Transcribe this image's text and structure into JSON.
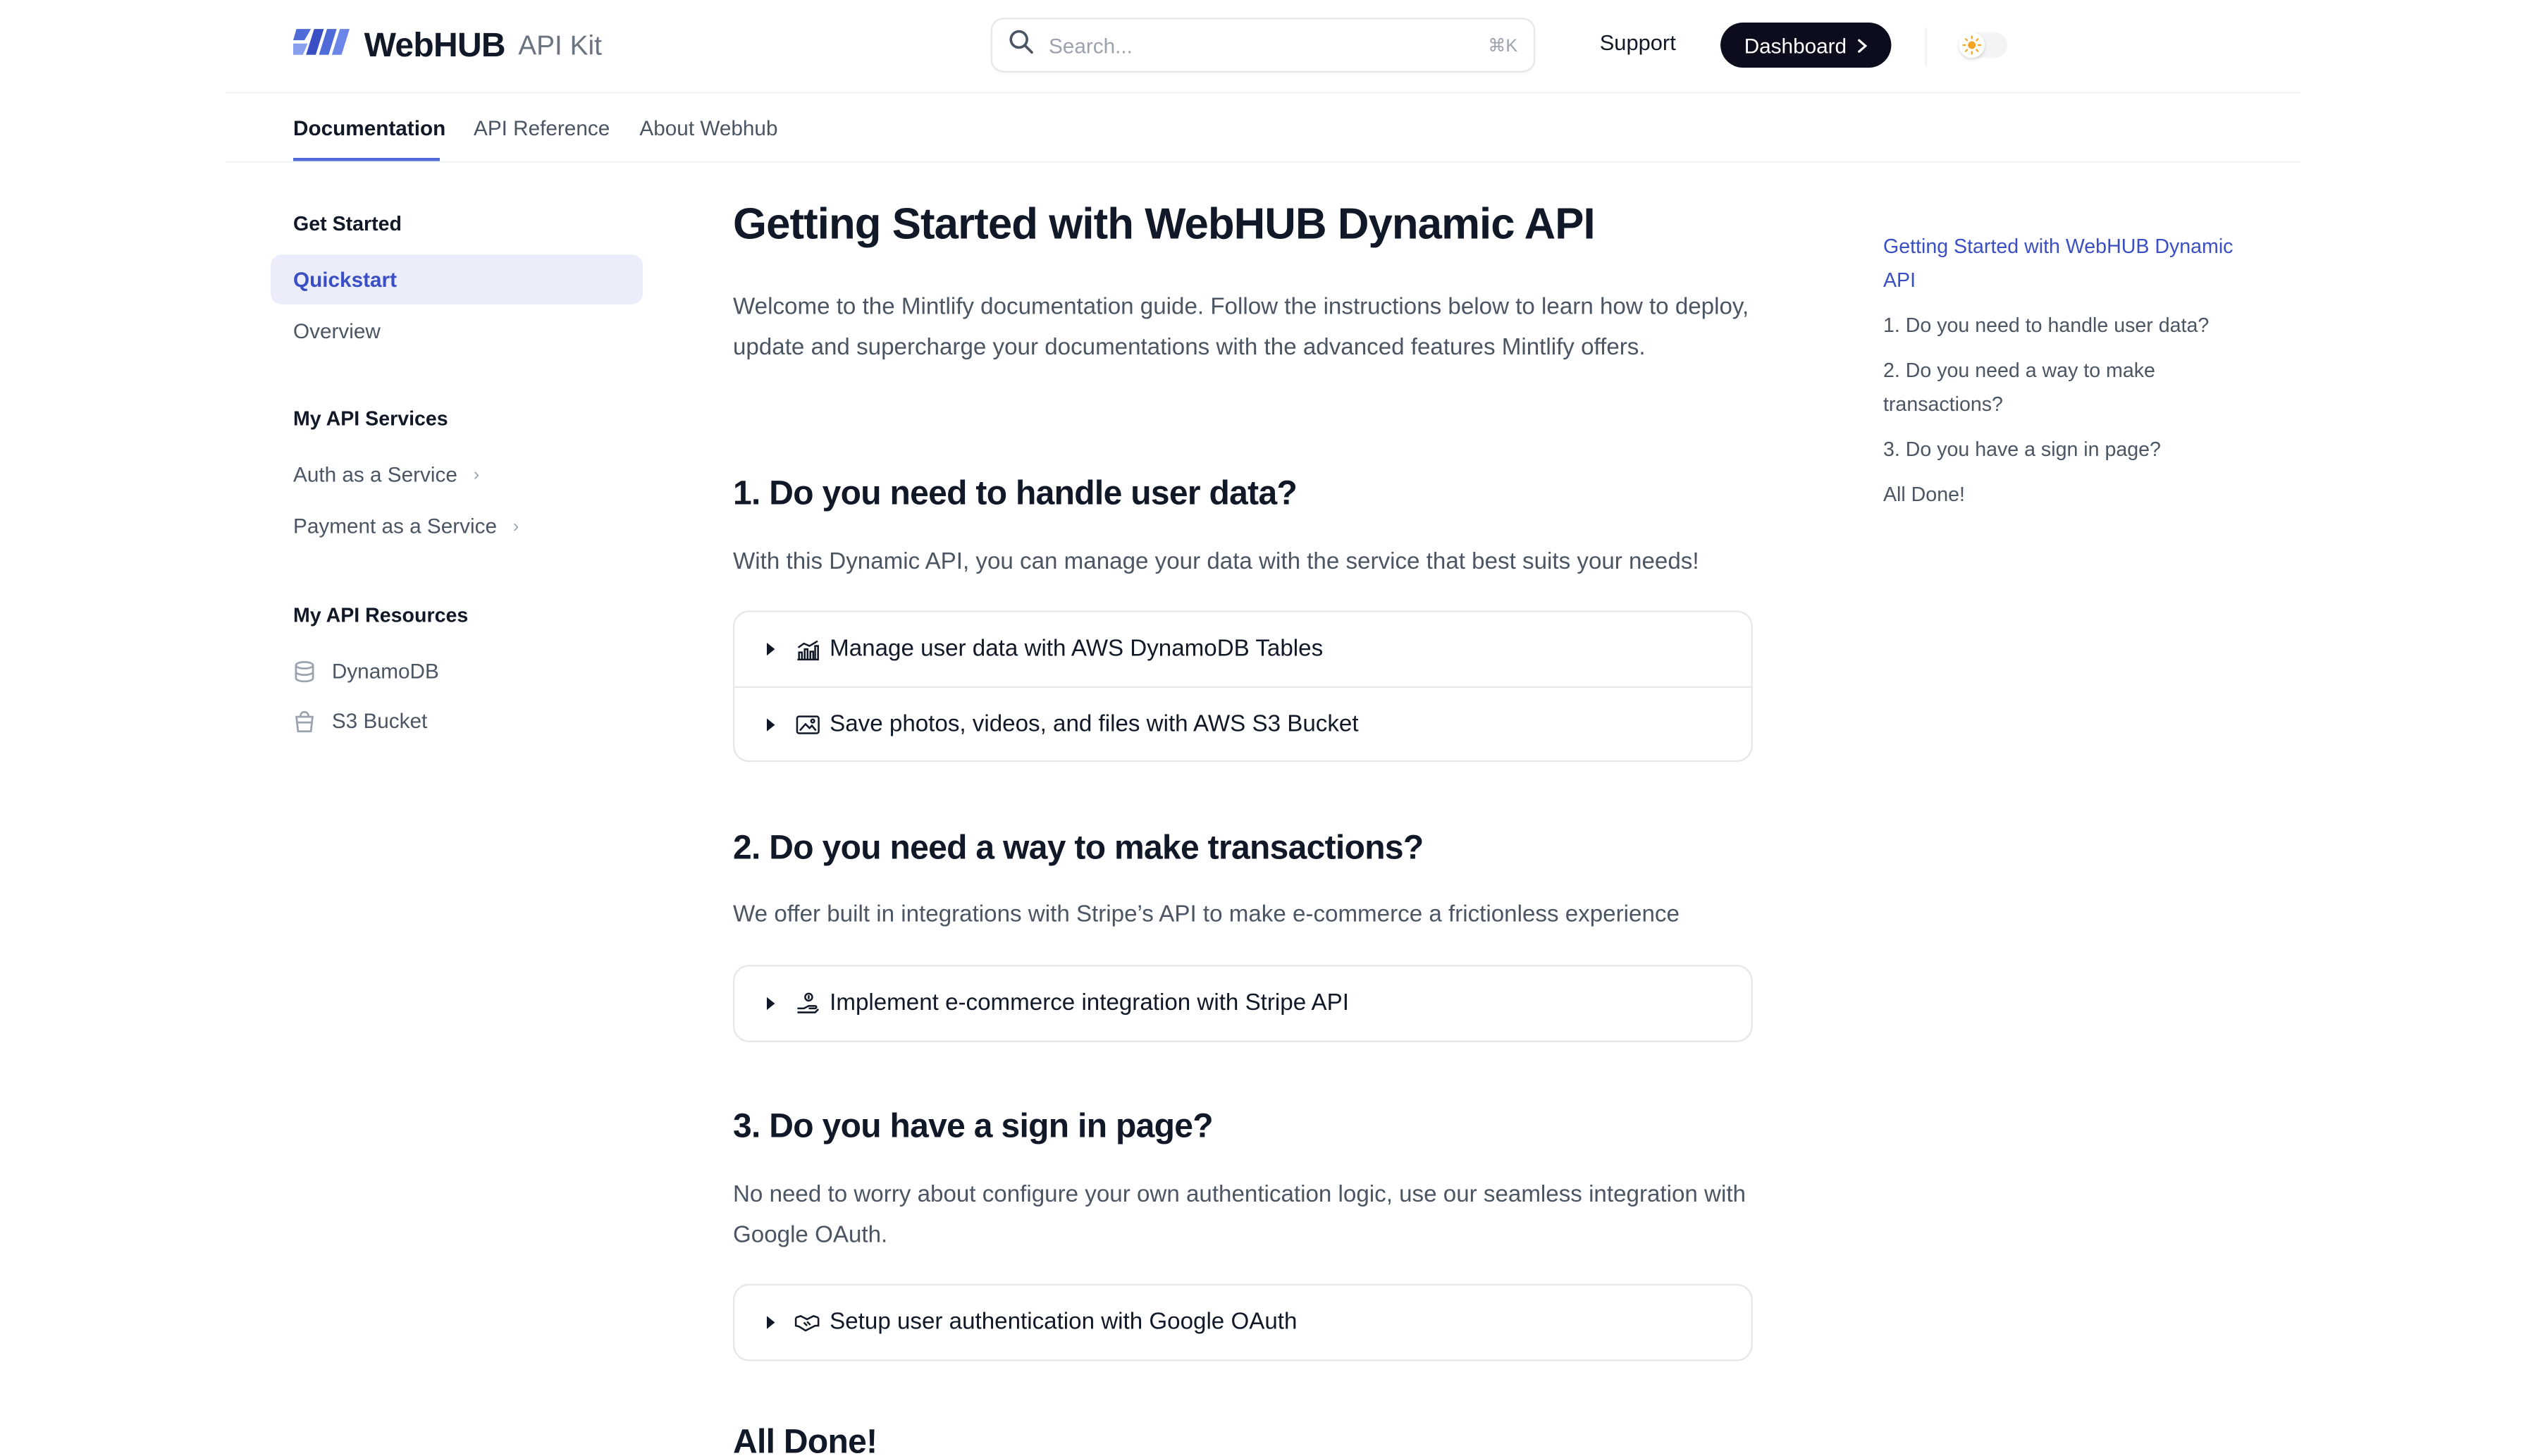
{
  "brand": {
    "name": "WebHUB",
    "subtitle": "API Kit"
  },
  "search": {
    "placeholder": "Search...",
    "shortcut": "⌘K"
  },
  "header": {
    "support": "Support",
    "dashboard": "Dashboard"
  },
  "tabs": [
    {
      "label": "Documentation",
      "active": true
    },
    {
      "label": "API Reference"
    },
    {
      "label": "About Webhub"
    }
  ],
  "sidebar": {
    "get_started": {
      "heading": "Get Started",
      "items": [
        "Quickstart",
        "Overview"
      ]
    },
    "services": {
      "heading": "My API Services",
      "items": [
        "Auth as a Service",
        "Payment as a Service"
      ]
    },
    "resources": {
      "heading": "My API Resources",
      "items": [
        {
          "label": "DynamoDB",
          "icon": "database-icon"
        },
        {
          "label": "S3 Bucket",
          "icon": "bucket-icon"
        }
      ]
    }
  },
  "main": {
    "title": "Getting Started with WebHUB Dynamic API",
    "intro": "Welcome to the Mintlify documentation guide. Follow the instructions below to learn how to deploy, update and supercharge your documentations with the advanced features Mintlify offers.",
    "sections": [
      {
        "heading": "1. Do you need to handle user data?",
        "text": "With this Dynamic API, you can manage your data with the service that best suits your needs!",
        "accordions": [
          {
            "label": "Manage user data with AWS DynamoDB Tables",
            "icon": "chart-icon"
          },
          {
            "label": "Save photos, videos, and files with AWS S3 Bucket",
            "icon": "image-icon"
          }
        ]
      },
      {
        "heading": "2. Do you need a way to make transactions?",
        "text": "We offer built in integrations with Stripe’s API to make e-commerce a frictionless experience",
        "accordions": [
          {
            "label": "Implement e-commerce integration with Stripe API",
            "icon": "money-hand-icon"
          }
        ]
      },
      {
        "heading": "3. Do you have a sign in page?",
        "text": "No need to worry about configure your own authentication logic, use our seamless integration with Google OAuth.",
        "accordions": [
          {
            "label": "Setup user authentication with Google OAuth",
            "icon": "handshake-icon"
          }
        ]
      },
      {
        "heading": "All Done!"
      }
    ]
  },
  "toc": [
    "Getting Started with WebHUB Dynamic API",
    "1. Do you need to handle user data?",
    "2. Do you need a way to make transactions?",
    "3. Do you have a sign in page?",
    "All Done!"
  ],
  "colors": {
    "accent": "#3b4fc4",
    "dashboard_bg": "#0b0d1d",
    "active_bg": "#ebedfa"
  }
}
